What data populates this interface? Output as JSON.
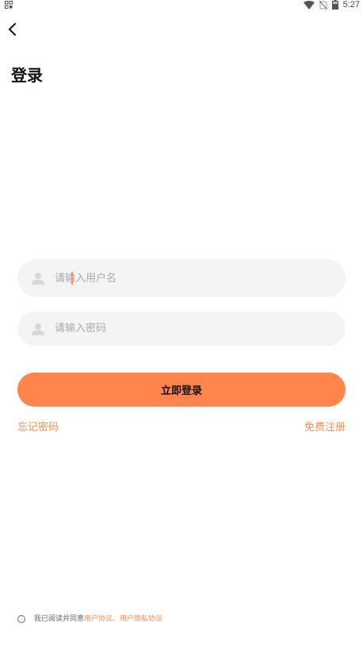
{
  "status_bar": {
    "time": "5:27",
    "icons": [
      "qr-grid-icon",
      "wifi-icon",
      "no-sim-icon",
      "battery-icon"
    ]
  },
  "header": {
    "back_icon": "chevron-left-icon",
    "title": "登录"
  },
  "form": {
    "username": {
      "placeholder": "请输入用户名",
      "value": "",
      "icon": "user-icon"
    },
    "password": {
      "placeholder": "请输入密码",
      "value": "",
      "icon": "user-icon"
    },
    "submit_label": "立即登录"
  },
  "links": {
    "forgot": "忘记密码",
    "register": "免费注册"
  },
  "agreement": {
    "prefix": "我已阅读并同意",
    "user_agreement": "用户协议",
    "separator": "、",
    "privacy_agreement": "用户隐私协议",
    "checked": false
  },
  "colors": {
    "accent": "#ff854d",
    "link": "#ff8a4c",
    "field_bg": "#f4f4f4",
    "placeholder": "#aaaaaa"
  }
}
